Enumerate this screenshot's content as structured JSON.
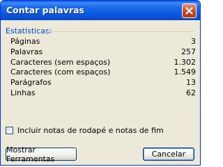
{
  "window": {
    "title": "Contar palavras"
  },
  "stats": {
    "group_label": "Estatísticas:",
    "rows": [
      {
        "label": "Páginas",
        "value": "3"
      },
      {
        "label": "Palavras",
        "value": "257"
      },
      {
        "label": "Caracteres (sem espaços)",
        "value": "1.302"
      },
      {
        "label": "Caracteres (com espaços)",
        "value": "1.549"
      },
      {
        "label": "Parágrafos",
        "value": "13"
      },
      {
        "label": "Linhas",
        "value": "62"
      }
    ]
  },
  "options": {
    "include_notes_label": "Incluir notas de rodapé e notas de fim",
    "include_notes_checked": false
  },
  "buttons": {
    "show_tools": "Mostrar Ferramentas",
    "cancel": "Cancelar"
  },
  "colors": {
    "titlebar": "#0A58DE",
    "group_label": "#0046D5",
    "dialog_bg": "#ECE9D8",
    "close_button": "#C8482A"
  }
}
